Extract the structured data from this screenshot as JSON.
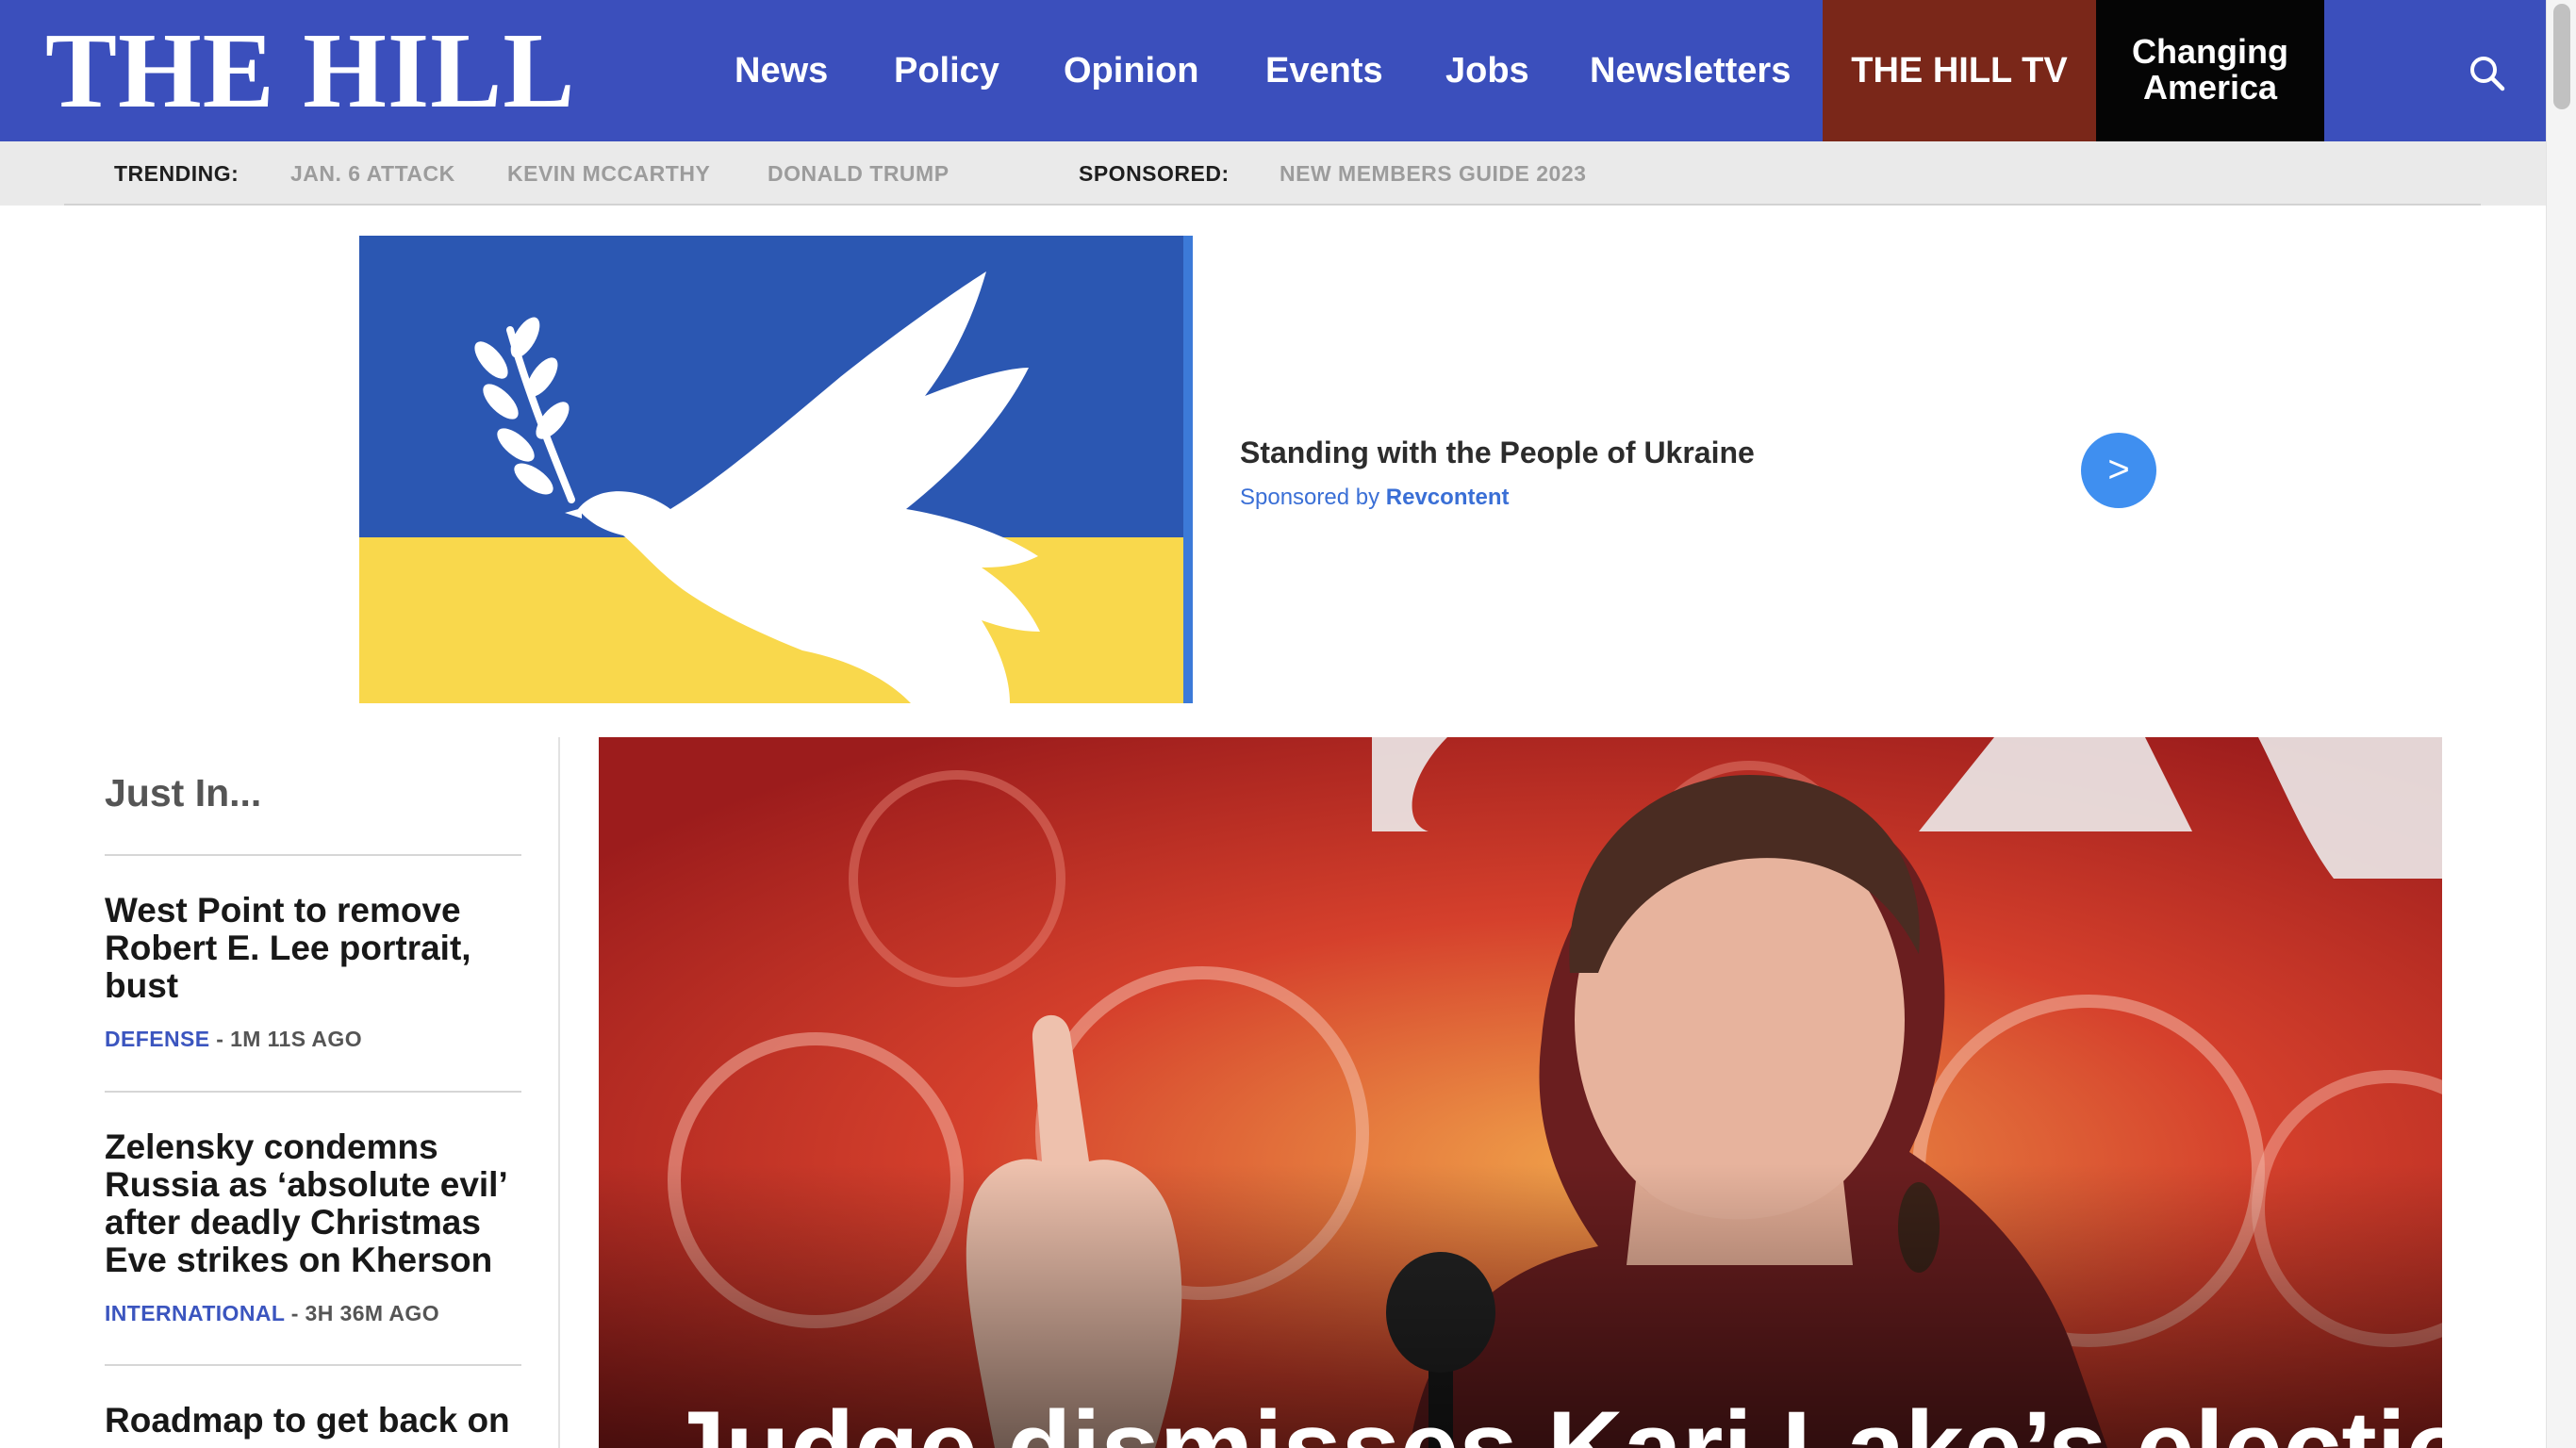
{
  "header": {
    "logo": "THE HILL",
    "nav": [
      "News",
      "Policy",
      "Opinion",
      "Events",
      "Jobs",
      "Newsletters"
    ],
    "tv_label": "THE HILL TV",
    "changing_line1": "Changing",
    "changing_line2": "America",
    "search_icon": "search-icon"
  },
  "trending": {
    "label": "TRENDING:",
    "items": [
      "JAN. 6 ATTACK",
      "KEVIN MCCARTHY",
      "DONALD TRUMP"
    ],
    "sponsored_label": "SPONSORED:",
    "sponsored_item": "NEW MEMBERS GUIDE 2023"
  },
  "ad": {
    "title": "Standing with the People of Ukraine",
    "sponsored_by": "Sponsored by",
    "sponsor": "Revcontent",
    "next_glyph": ">",
    "colors": {
      "blue": "#2b57b2",
      "yellow": "#f9d84c"
    }
  },
  "just_in": {
    "title": "Just In...",
    "stories": [
      {
        "headline": "West Point to remove Robert E. Lee portrait, bust",
        "category": "DEFENSE",
        "time": " - 1M 11S AGO"
      },
      {
        "headline": "Zelensky condemns Russia as ‘absolute evil’ after deadly Christmas Eve strikes on Kherson",
        "category": "INTERNATIONAL",
        "time": " - 3H 36M AGO"
      },
      {
        "headline": "Roadmap to get back on",
        "category": "",
        "time": ""
      }
    ]
  },
  "hero": {
    "headline": "Judge dismisses Kari Lake’s election"
  },
  "colors": {
    "nav_bg": "#3b4fbc",
    "tv_bg": "#7a2719",
    "changing_bg": "#050505",
    "category": "#3b55bf"
  }
}
